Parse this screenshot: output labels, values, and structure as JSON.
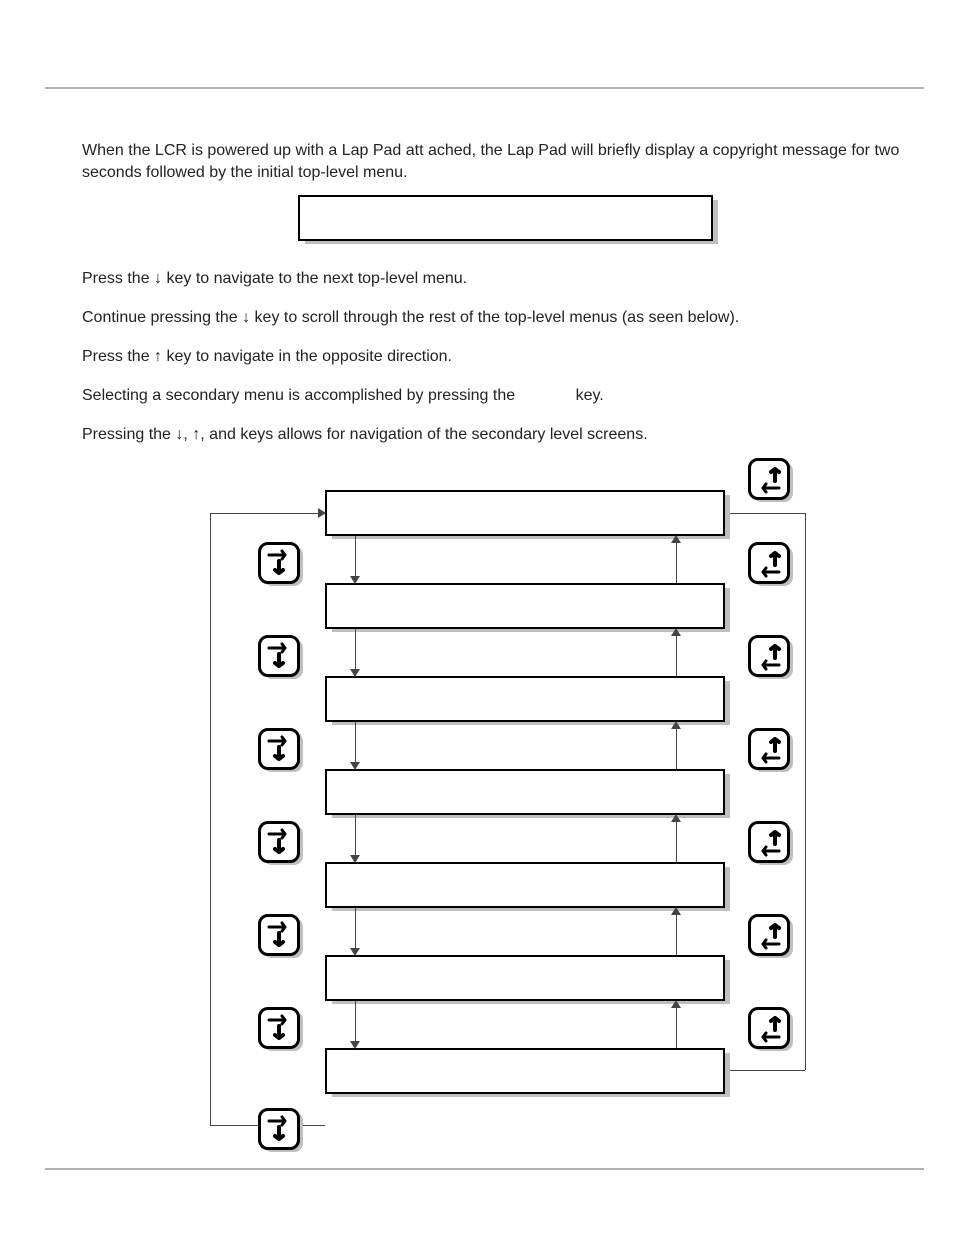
{
  "paragraphs": {
    "p1": "When the LCR is powered up with a Lap Pad att ached, the Lap Pad will briefly display a copyright message for two seconds followed by the initial top-level menu.",
    "p2a": "Press the ",
    "p2b": " key to navigate to the next top-level menu.",
    "p3a": "Continue pressing the ",
    "p3b": " key to scroll through the rest of the top-level menus (as seen below).",
    "p4a": "Press the ",
    "p4b": " key to navigate in the opposite direction.",
    "p5a": "Selecting a secondary menu is accomplished by pressing the ",
    "p5b": " key.",
    "p6a": "Pressing the ",
    "p6b": ", ",
    "p6c": ",       and       keys allows for navigation of the secondary level screens."
  },
  "display": {
    "text": ""
  },
  "menus": [
    {
      "label": ""
    },
    {
      "label": ""
    },
    {
      "label": ""
    },
    {
      "label": ""
    },
    {
      "label": ""
    },
    {
      "label": ""
    },
    {
      "label": ""
    }
  ],
  "icons": {
    "nav_right_down": "right-down-key",
    "nav_up_left": "up-left-key"
  }
}
